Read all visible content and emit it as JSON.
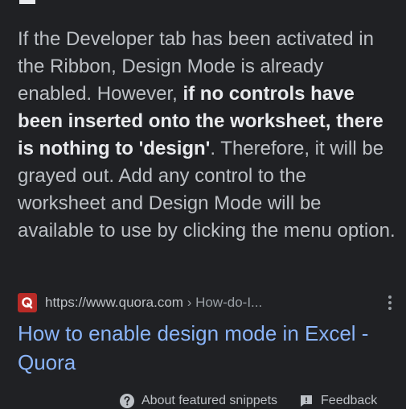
{
  "snippet": {
    "text_before": "If the Developer tab has been activated in the Ribbon, Design Mode is already enabled. However, ",
    "text_bold": "if no controls have been inserted onto the worksheet, there is nothing to 'design'",
    "text_after": ". Therefore, it will be grayed out. Add any control to the worksheet and Design Mode will be available to use by clicking the menu option."
  },
  "source": {
    "favicon_icon": "quora-logo-icon",
    "domain": "https://www.quora.com",
    "breadcrumb": " › How-do-I...",
    "menu_icon": "more-vert-icon"
  },
  "result": {
    "title": "How to enable design mode in Excel - Quora"
  },
  "footer": {
    "about_label": "About featured snippets",
    "feedback_label": "Feedback"
  },
  "colors": {
    "background": "#202124",
    "link": "#8ab4f8",
    "text": "#bdc1c6",
    "quora_red": "#b92b27"
  }
}
